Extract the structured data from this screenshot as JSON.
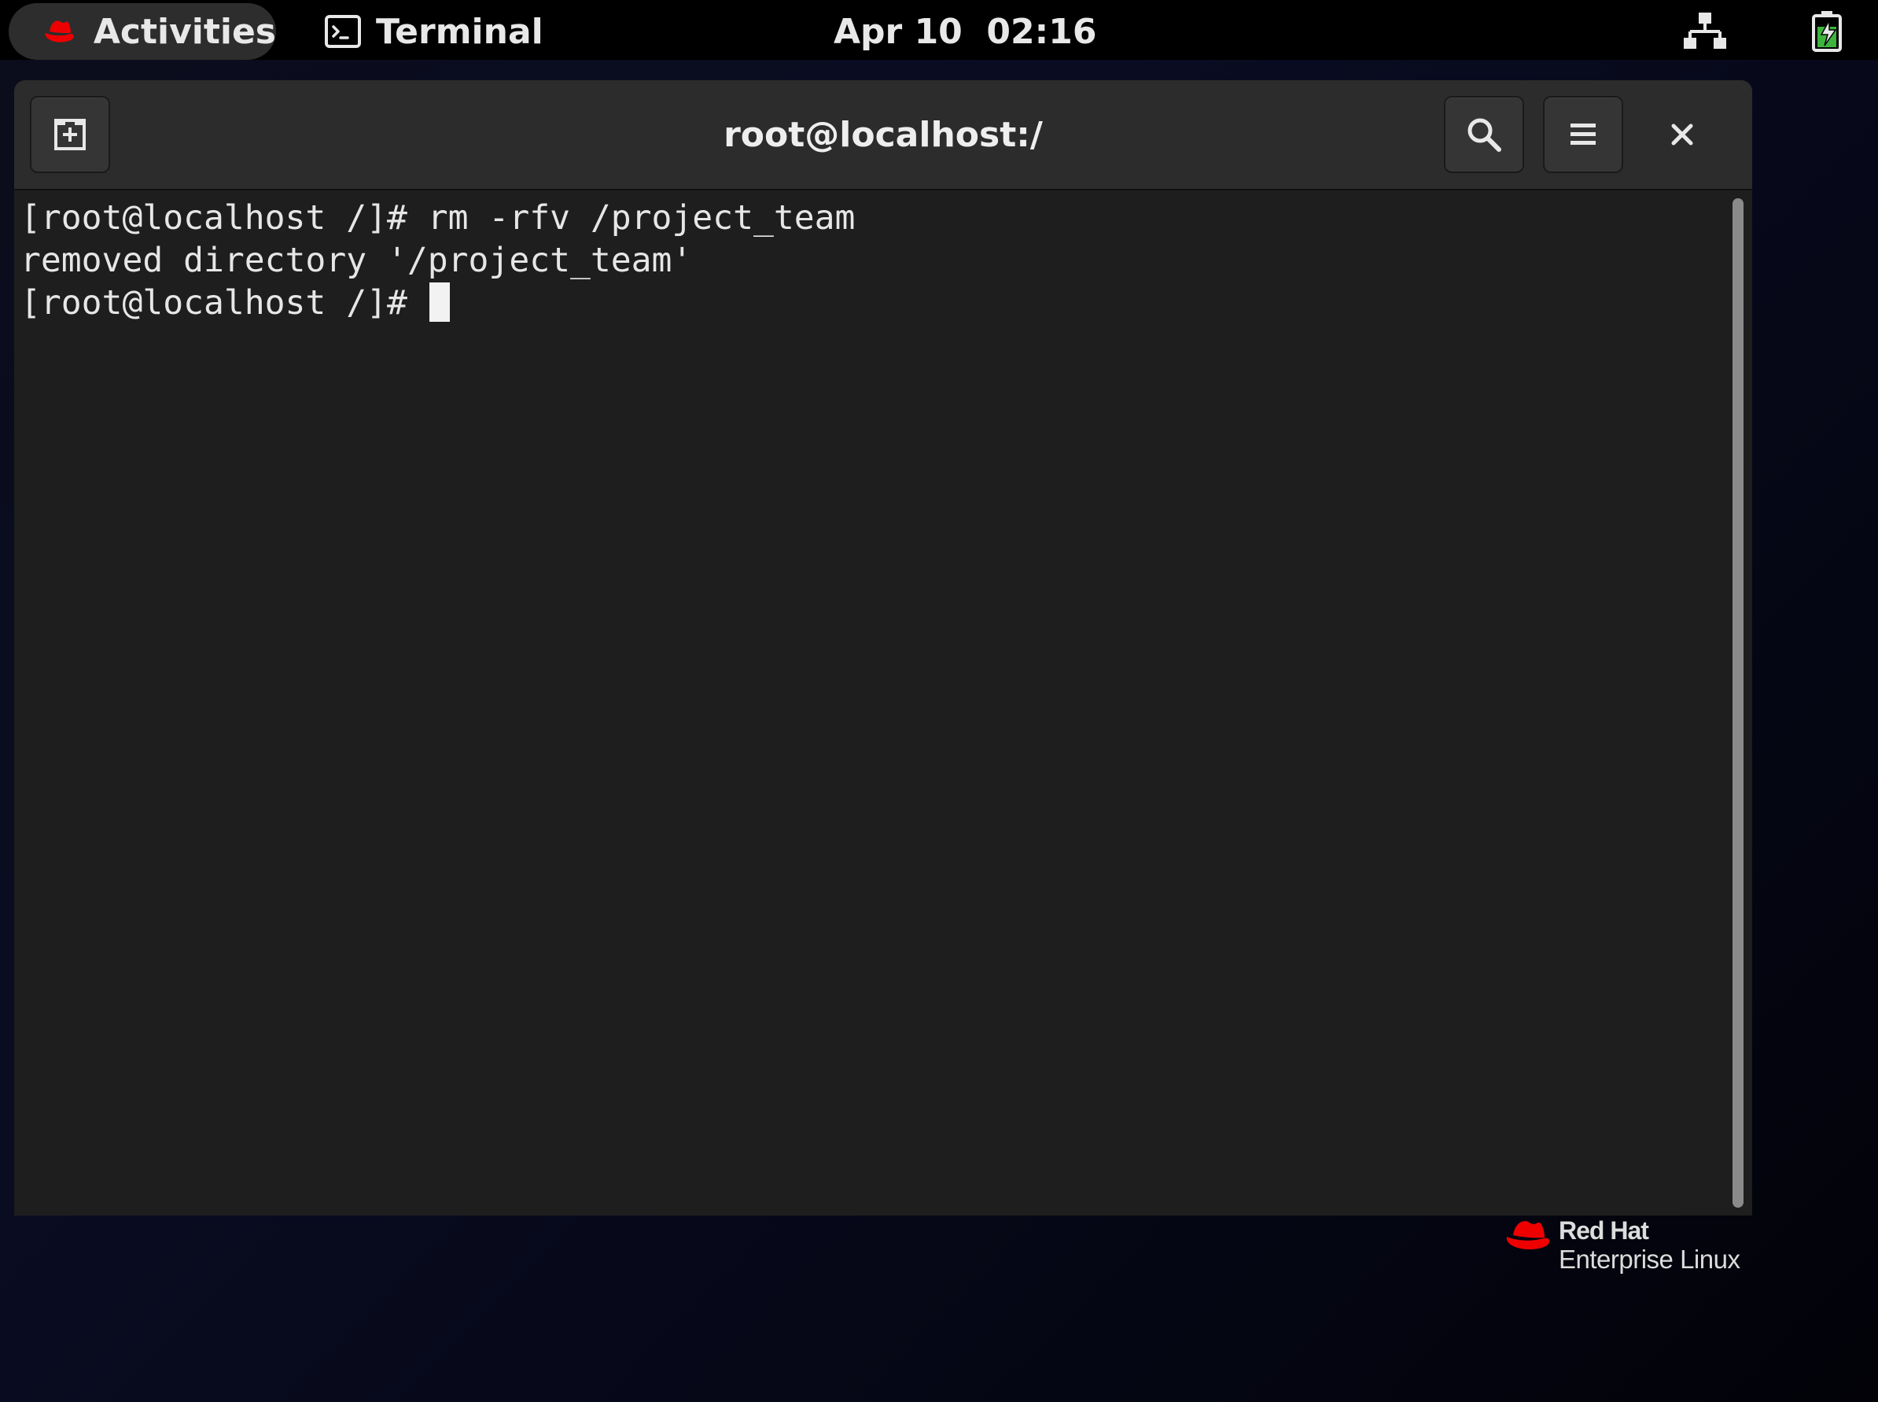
{
  "topbar": {
    "activities_label": "Activities",
    "app_name": "Terminal",
    "clock": "Apr 10  02:16",
    "tray_icons": [
      "network-wired-icon",
      "battery-charging-icon"
    ]
  },
  "window": {
    "title": "root@localhost:/",
    "header_buttons": [
      "new-tab-icon",
      "search-icon",
      "hamburger-menu-icon",
      "close-icon"
    ]
  },
  "terminal": {
    "lines": [
      "[root@localhost /]# rm -rfv /project_team",
      "removed directory '/project_team'",
      "[root@localhost /]# "
    ]
  },
  "branding": {
    "line1": "Red Hat",
    "line2": "Enterprise Linux"
  },
  "colors": {
    "redhat_red": "#ee0000",
    "terminal_bg": "#1e1e1e",
    "headerbar_bg": "#2c2c2c",
    "battery_green": "#3eb43e"
  }
}
